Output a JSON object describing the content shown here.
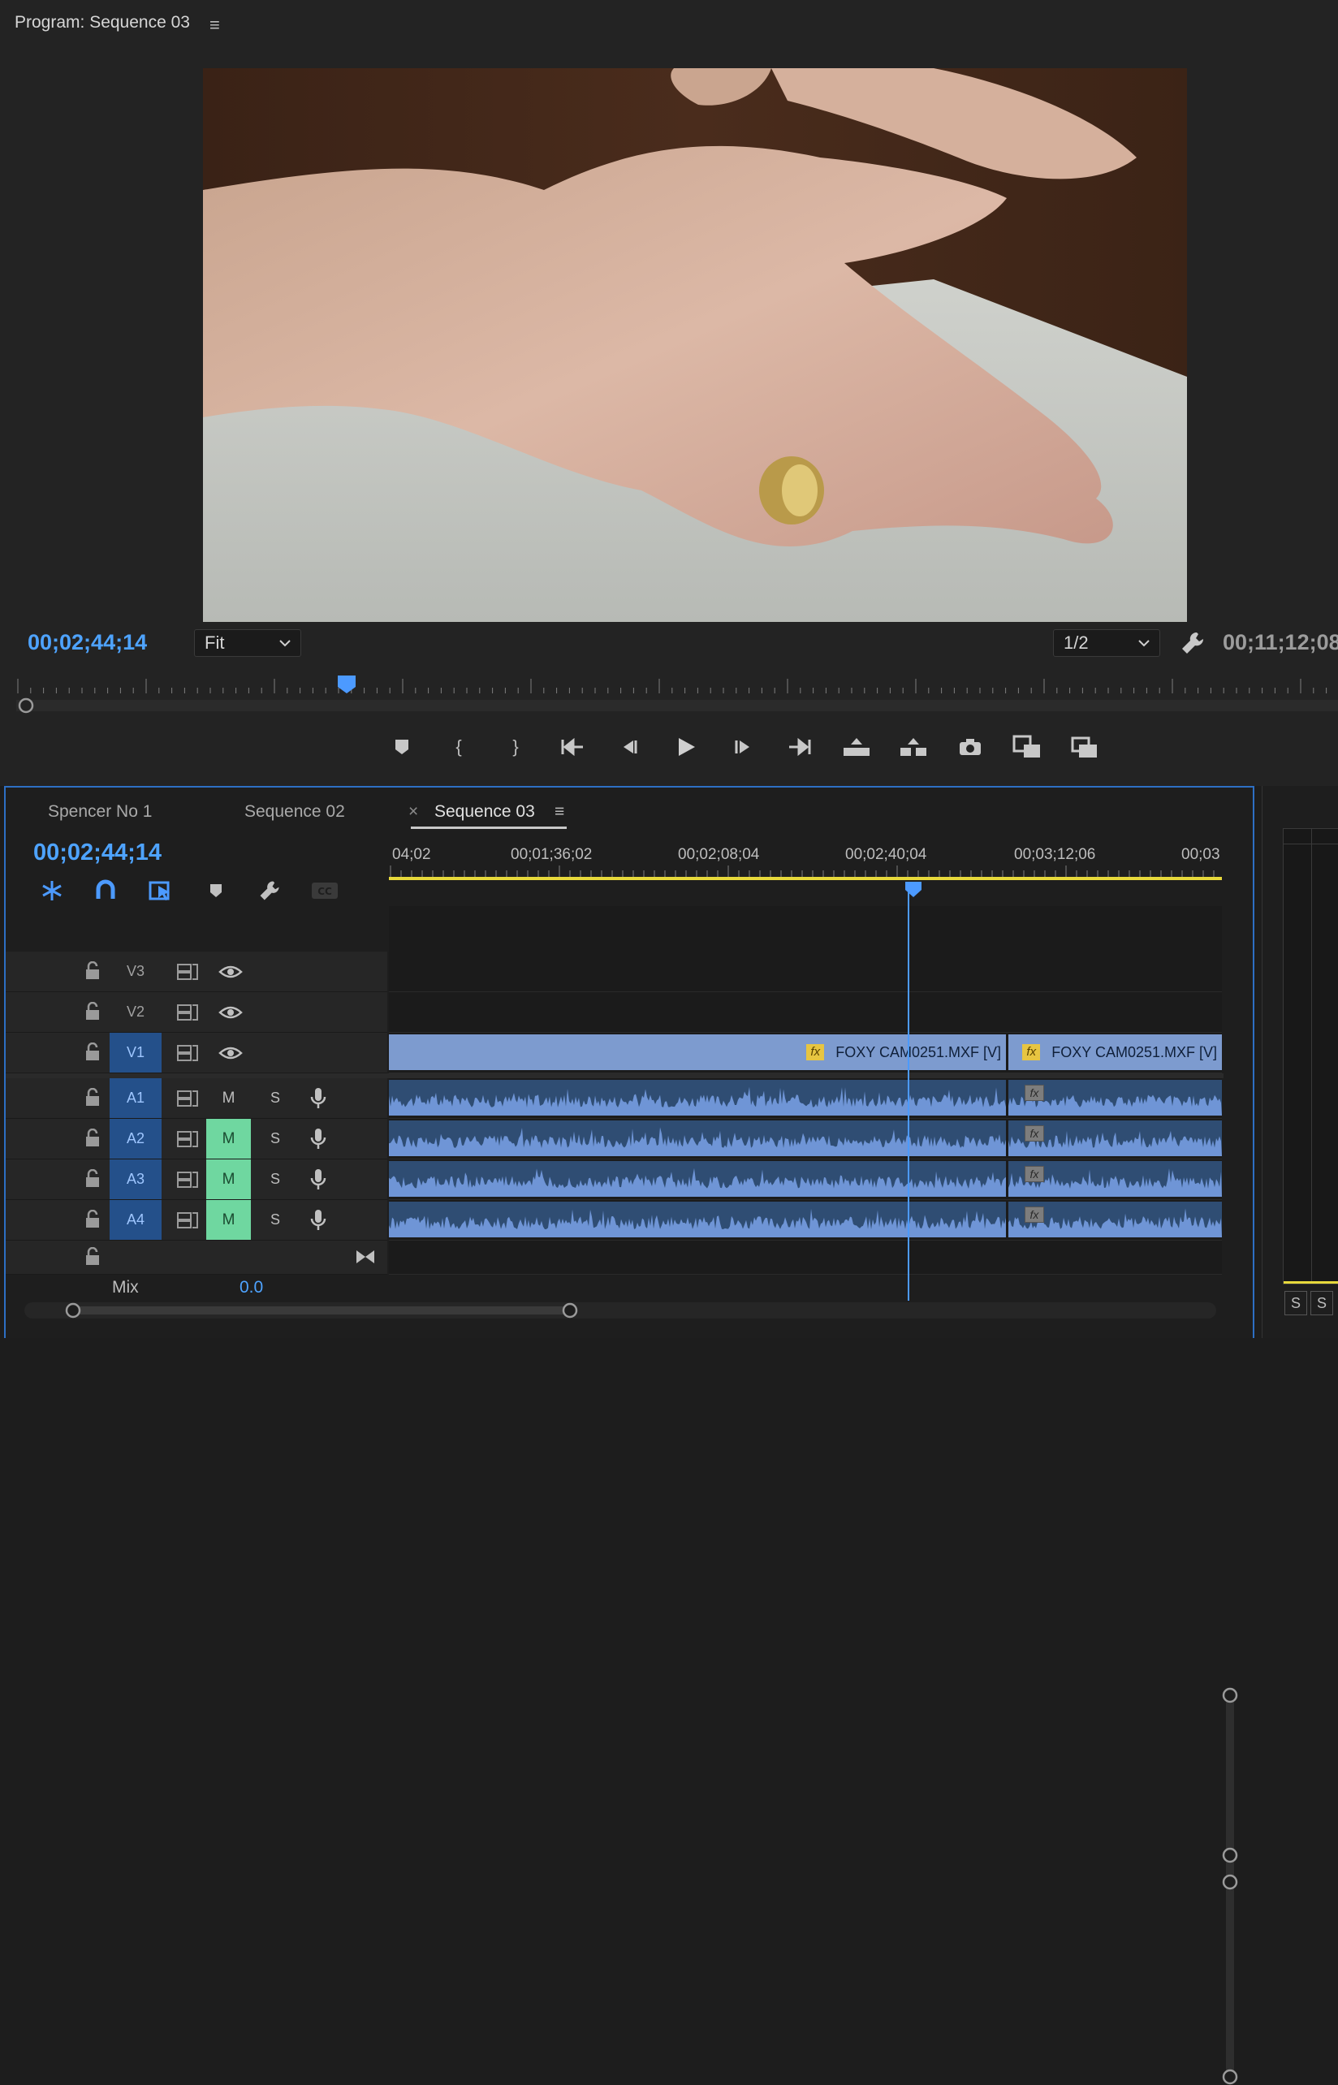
{
  "program_monitor": {
    "title": "Program: Sequence 03",
    "menu_icon": "hamburger-icon",
    "current_timecode": "00;02;44;14",
    "zoom": "Fit",
    "resolution": "1/2",
    "duration_timecode": "00;11;12;08",
    "transport": [
      "add-marker-icon",
      "mark-in-icon",
      "mark-out-icon",
      "go-to-in-icon",
      "step-back-icon",
      "play-icon",
      "step-forward-icon",
      "go-to-out-icon",
      "lift-icon",
      "extract-icon",
      "export-frame-icon",
      "insert-icon",
      "overwrite-icon"
    ]
  },
  "timeline": {
    "tabs": [
      {
        "label": "Spencer No 1",
        "active": false
      },
      {
        "label": "Sequence 02",
        "active": false
      },
      {
        "label": "Sequence 03",
        "active": true
      }
    ],
    "close_glyph": "×",
    "menu_glyph": "≡",
    "current_timecode": "00;02;44;14",
    "ruler_labels": [
      "04;02",
      "00;01;36;02",
      "00;02;08;04",
      "00;02;40;04",
      "00;03;12;06",
      "00;03"
    ],
    "playhead_fraction": 0.627,
    "tracks": {
      "v3": "V3",
      "v2": "V2",
      "v1": "V1",
      "a1": "A1",
      "a2": "A2",
      "a3": "A3",
      "a4": "A4"
    },
    "mute_label": "M",
    "solo_label": "S",
    "clips": {
      "v1_clip1_label": "FOXY CAM0251.MXF [V]",
      "v1_clip2_label": "FOXY CAM0251.MXF [V]",
      "fx": "fx"
    },
    "mix_label": "Mix",
    "mix_value": "0.0"
  },
  "colors": {
    "accent_blue": "#4ea3ff",
    "video_clip": "#7d9bcf",
    "audio_clip": "#2f4d73",
    "mute_on": "#6fd7a0",
    "work_area": "#e7d93b"
  },
  "side_panel": {
    "s1": "S",
    "s2": "S"
  }
}
